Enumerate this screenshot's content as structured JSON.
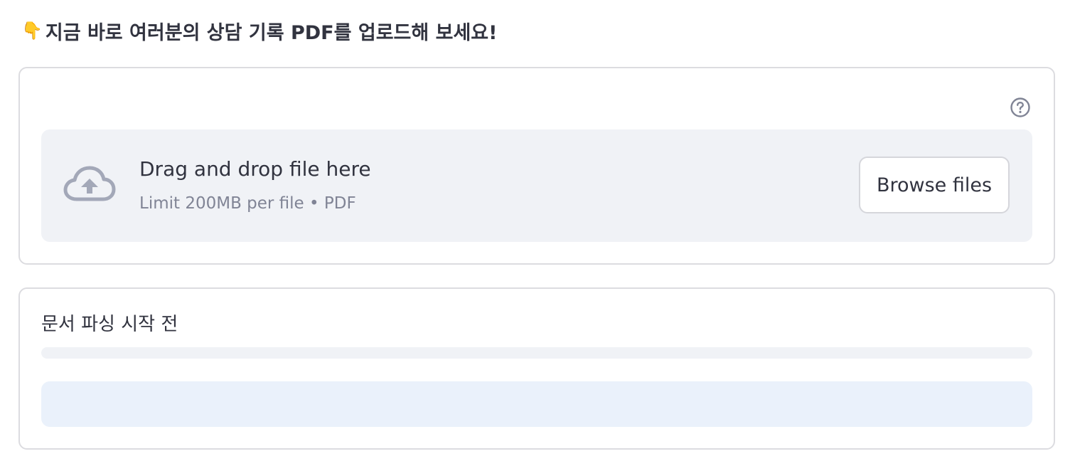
{
  "header": {
    "emoji": "👇",
    "title": "지금 바로 여러분의 상담 기록 PDF를 업로드해 보세요!"
  },
  "uploader": {
    "help_icon": "question-circle-icon",
    "cloud_icon": "cloud-upload-icon",
    "drop_label": "Drag and drop file here",
    "limit_label": "Limit 200MB per file • PDF",
    "browse_label": "Browse files"
  },
  "status": {
    "label": "문서 파싱 시작 전",
    "progress": 0,
    "info_text": ""
  },
  "colors": {
    "text": "#31333f",
    "muted_text": "#808495",
    "dropzone_bg": "#f0f2f6",
    "info_bg": "#eaf1fb",
    "icon": "#a3a8b8"
  }
}
